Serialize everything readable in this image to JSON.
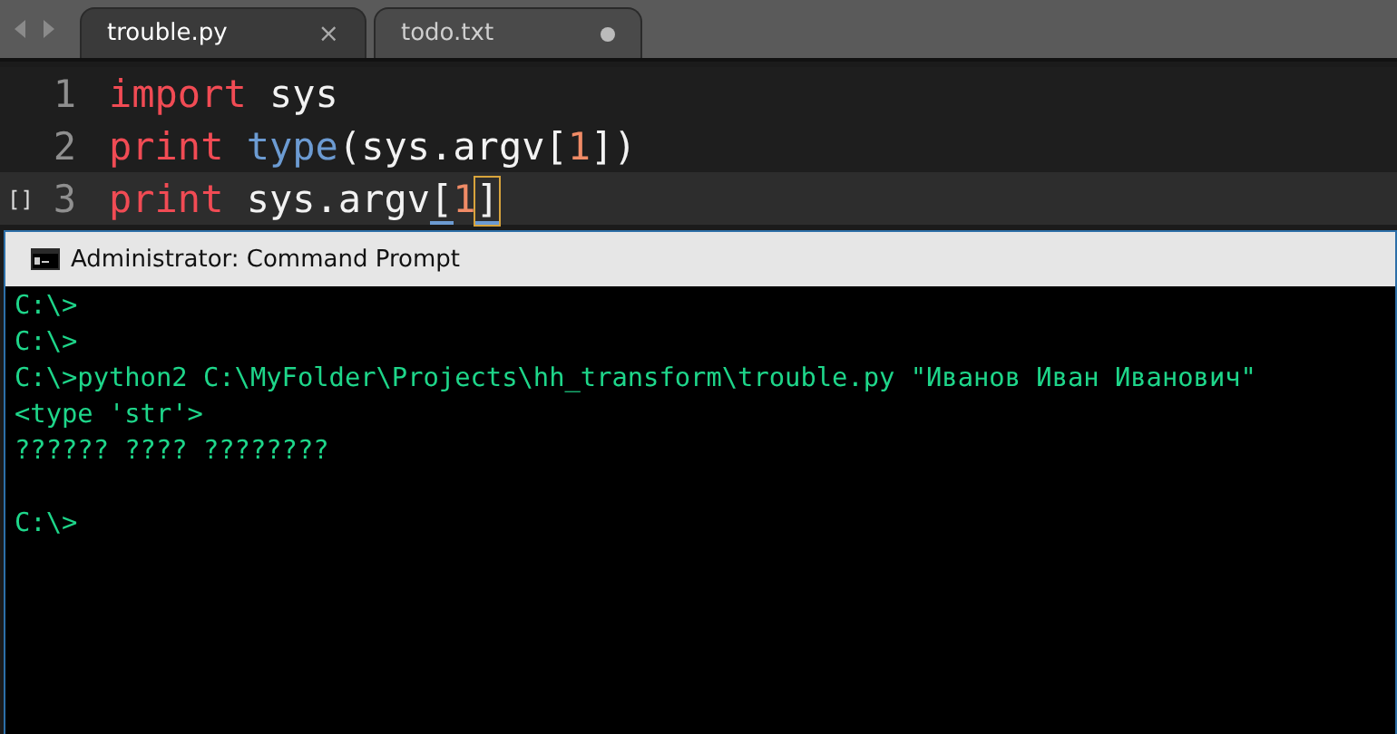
{
  "tabs": [
    {
      "label": "trouble.py",
      "selected": true,
      "dirty": false,
      "close": "×"
    },
    {
      "label": "todo.txt",
      "selected": false,
      "dirty": true
    }
  ],
  "code_lines": [
    {
      "number": "1",
      "current": false,
      "tokens": [
        {
          "kind": "keyword",
          "text": "import"
        },
        {
          "kind": "plain",
          "text": " sys"
        }
      ]
    },
    {
      "number": "2",
      "current": false,
      "tokens": [
        {
          "kind": "keyword",
          "text": "print "
        },
        {
          "kind": "builtin",
          "text": "type"
        },
        {
          "kind": "plain",
          "text": "(sys.argv["
        },
        {
          "kind": "number",
          "text": "1"
        },
        {
          "kind": "plain",
          "text": "])"
        }
      ]
    },
    {
      "number": "3",
      "current": true,
      "gutter_mark": "[]",
      "tokens": [
        {
          "kind": "keyword",
          "text": "print"
        },
        {
          "kind": "plain",
          "text": " sys.argv"
        },
        {
          "kind": "match",
          "text": "["
        },
        {
          "kind": "number",
          "text": "1"
        },
        {
          "kind": "match_cursor",
          "text": "]"
        }
      ]
    }
  ],
  "console": {
    "title": "Administrator: Command Prompt",
    "blocks": [
      [
        "C:\\>",
        "C:\\>",
        "C:\\>python2 C:\\MyFolder\\Projects\\hh_transform\\trouble.py \"Иванов Иван Иванович\"",
        "<type 'str'>",
        "?????? ???? ????????"
      ],
      [
        "C:\\>"
      ]
    ]
  }
}
